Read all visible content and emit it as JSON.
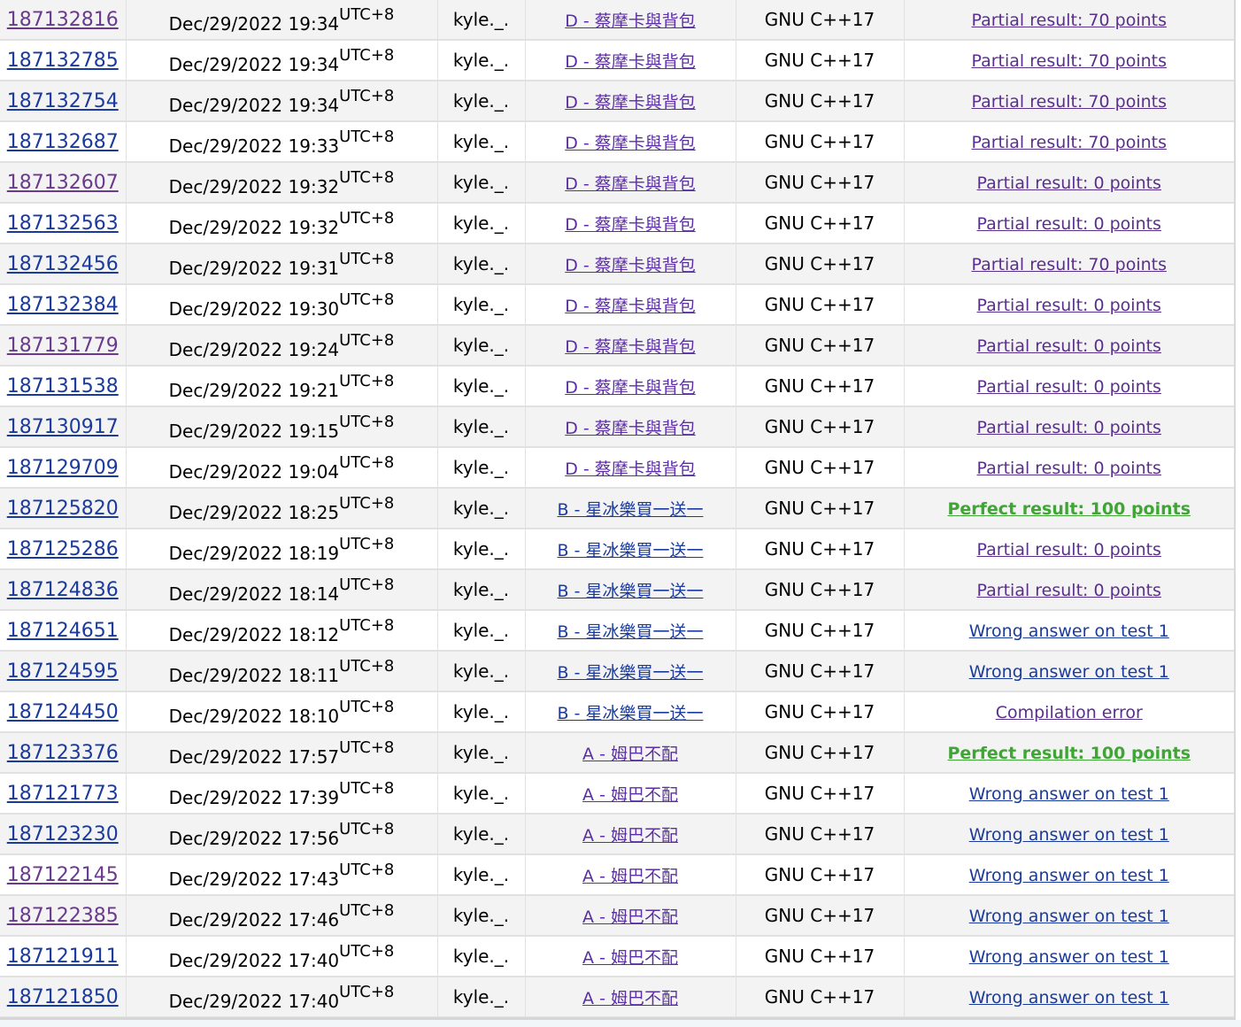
{
  "timezone": "UTC+8",
  "language": "GNU C++17",
  "problems": {
    "A": "A - 姆巴不配",
    "B": "B - 星冰樂買一送一",
    "D": "D - 蔡摩卡與背包"
  },
  "verdicts": {
    "partial70": "Partial result: 70 points",
    "partial0": "Partial result: 0 points",
    "perfect": "Perfect result: 100 points",
    "wrong1": "Wrong answer on test 1",
    "compile": "Compilation error"
  },
  "submissions": [
    {
      "id": "187132816",
      "when": "Dec/29/2022 19:34",
      "tz": "UTC+8",
      "who": "kyle._.",
      "problem": "D - 蔡摩卡與背包",
      "lang": "GNU C++17",
      "verdict": "Partial result: 70 points",
      "verdict_type": "partial",
      "id_visited": true,
      "problem_color": "purple"
    },
    {
      "id": "187132785",
      "when": "Dec/29/2022 19:34",
      "tz": "UTC+8",
      "who": "kyle._.",
      "problem": "D - 蔡摩卡與背包",
      "lang": "GNU C++17",
      "verdict": "Partial result: 70 points",
      "verdict_type": "partial",
      "id_visited": false,
      "problem_color": "purple"
    },
    {
      "id": "187132754",
      "when": "Dec/29/2022 19:34",
      "tz": "UTC+8",
      "who": "kyle._.",
      "problem": "D - 蔡摩卡與背包",
      "lang": "GNU C++17",
      "verdict": "Partial result: 70 points",
      "verdict_type": "partial",
      "id_visited": false,
      "problem_color": "purple"
    },
    {
      "id": "187132687",
      "when": "Dec/29/2022 19:33",
      "tz": "UTC+8",
      "who": "kyle._.",
      "problem": "D - 蔡摩卡與背包",
      "lang": "GNU C++17",
      "verdict": "Partial result: 70 points",
      "verdict_type": "partial",
      "id_visited": false,
      "problem_color": "purple"
    },
    {
      "id": "187132607",
      "when": "Dec/29/2022 19:32",
      "tz": "UTC+8",
      "who": "kyle._.",
      "problem": "D - 蔡摩卡與背包",
      "lang": "GNU C++17",
      "verdict": "Partial result: 0 points",
      "verdict_type": "partial",
      "id_visited": true,
      "problem_color": "purple"
    },
    {
      "id": "187132563",
      "when": "Dec/29/2022 19:32",
      "tz": "UTC+8",
      "who": "kyle._.",
      "problem": "D - 蔡摩卡與背包",
      "lang": "GNU C++17",
      "verdict": "Partial result: 0 points",
      "verdict_type": "partial",
      "id_visited": false,
      "problem_color": "purple"
    },
    {
      "id": "187132456",
      "when": "Dec/29/2022 19:31",
      "tz": "UTC+8",
      "who": "kyle._.",
      "problem": "D - 蔡摩卡與背包",
      "lang": "GNU C++17",
      "verdict": "Partial result: 70 points",
      "verdict_type": "partial",
      "id_visited": false,
      "problem_color": "purple"
    },
    {
      "id": "187132384",
      "when": "Dec/29/2022 19:30",
      "tz": "UTC+8",
      "who": "kyle._.",
      "problem": "D - 蔡摩卡與背包",
      "lang": "GNU C++17",
      "verdict": "Partial result: 0 points",
      "verdict_type": "partial",
      "id_visited": false,
      "problem_color": "purple"
    },
    {
      "id": "187131779",
      "when": "Dec/29/2022 19:24",
      "tz": "UTC+8",
      "who": "kyle._.",
      "problem": "D - 蔡摩卡與背包",
      "lang": "GNU C++17",
      "verdict": "Partial result: 0 points",
      "verdict_type": "partial",
      "id_visited": true,
      "problem_color": "purple"
    },
    {
      "id": "187131538",
      "when": "Dec/29/2022 19:21",
      "tz": "UTC+8",
      "who": "kyle._.",
      "problem": "D - 蔡摩卡與背包",
      "lang": "GNU C++17",
      "verdict": "Partial result: 0 points",
      "verdict_type": "partial",
      "id_visited": false,
      "problem_color": "purple"
    },
    {
      "id": "187130917",
      "when": "Dec/29/2022 19:15",
      "tz": "UTC+8",
      "who": "kyle._.",
      "problem": "D - 蔡摩卡與背包",
      "lang": "GNU C++17",
      "verdict": "Partial result: 0 points",
      "verdict_type": "partial",
      "id_visited": false,
      "problem_color": "purple"
    },
    {
      "id": "187129709",
      "when": "Dec/29/2022 19:04",
      "tz": "UTC+8",
      "who": "kyle._.",
      "problem": "D - 蔡摩卡與背包",
      "lang": "GNU C++17",
      "verdict": "Partial result: 0 points",
      "verdict_type": "partial",
      "id_visited": false,
      "problem_color": "purple"
    },
    {
      "id": "187125820",
      "when": "Dec/29/2022 18:25",
      "tz": "UTC+8",
      "who": "kyle._.",
      "problem": "B - 星冰樂買一送一",
      "lang": "GNU C++17",
      "verdict": "Perfect result: 100 points",
      "verdict_type": "perfect",
      "id_visited": false,
      "problem_color": "blue"
    },
    {
      "id": "187125286",
      "when": "Dec/29/2022 18:19",
      "tz": "UTC+8",
      "who": "kyle._.",
      "problem": "B - 星冰樂買一送一",
      "lang": "GNU C++17",
      "verdict": "Partial result: 0 points",
      "verdict_type": "partial",
      "id_visited": false,
      "problem_color": "blue"
    },
    {
      "id": "187124836",
      "when": "Dec/29/2022 18:14",
      "tz": "UTC+8",
      "who": "kyle._.",
      "problem": "B - 星冰樂買一送一",
      "lang": "GNU C++17",
      "verdict": "Partial result: 0 points",
      "verdict_type": "partial",
      "id_visited": false,
      "problem_color": "blue"
    },
    {
      "id": "187124651",
      "when": "Dec/29/2022 18:12",
      "tz": "UTC+8",
      "who": "kyle._.",
      "problem": "B - 星冰樂買一送一",
      "lang": "GNU C++17",
      "verdict": "Wrong answer on test 1",
      "verdict_type": "wrong",
      "id_visited": false,
      "problem_color": "blue"
    },
    {
      "id": "187124595",
      "when": "Dec/29/2022 18:11",
      "tz": "UTC+8",
      "who": "kyle._.",
      "problem": "B - 星冰樂買一送一",
      "lang": "GNU C++17",
      "verdict": "Wrong answer on test 1",
      "verdict_type": "wrong",
      "id_visited": false,
      "problem_color": "blue"
    },
    {
      "id": "187124450",
      "when": "Dec/29/2022 18:10",
      "tz": "UTC+8",
      "who": "kyle._.",
      "problem": "B - 星冰樂買一送一",
      "lang": "GNU C++17",
      "verdict": "Compilation error",
      "verdict_type": "compile",
      "id_visited": false,
      "problem_color": "blue"
    },
    {
      "id": "187123376",
      "when": "Dec/29/2022 17:57",
      "tz": "UTC+8",
      "who": "kyle._.",
      "problem": "A - 姆巴不配",
      "lang": "GNU C++17",
      "verdict": "Perfect result: 100 points",
      "verdict_type": "perfect",
      "id_visited": false,
      "problem_color": "purple"
    },
    {
      "id": "187121773",
      "when": "Dec/29/2022 17:39",
      "tz": "UTC+8",
      "who": "kyle._.",
      "problem": "A - 姆巴不配",
      "lang": "GNU C++17",
      "verdict": "Wrong answer on test 1",
      "verdict_type": "wrong",
      "id_visited": false,
      "problem_color": "purple"
    },
    {
      "id": "187123230",
      "when": "Dec/29/2022 17:56",
      "tz": "UTC+8",
      "who": "kyle._.",
      "problem": "A - 姆巴不配",
      "lang": "GNU C++17",
      "verdict": "Wrong answer on test 1",
      "verdict_type": "wrong",
      "id_visited": false,
      "problem_color": "purple"
    },
    {
      "id": "187122145",
      "when": "Dec/29/2022 17:43",
      "tz": "UTC+8",
      "who": "kyle._.",
      "problem": "A - 姆巴不配",
      "lang": "GNU C++17",
      "verdict": "Wrong answer on test 1",
      "verdict_type": "wrong",
      "id_visited": true,
      "problem_color": "purple"
    },
    {
      "id": "187122385",
      "when": "Dec/29/2022 17:46",
      "tz": "UTC+8",
      "who": "kyle._.",
      "problem": "A - 姆巴不配",
      "lang": "GNU C++17",
      "verdict": "Wrong answer on test 1",
      "verdict_type": "wrong",
      "id_visited": true,
      "problem_color": "purple"
    },
    {
      "id": "187121911",
      "when": "Dec/29/2022 17:40",
      "tz": "UTC+8",
      "who": "kyle._.",
      "problem": "A - 姆巴不配",
      "lang": "GNU C++17",
      "verdict": "Wrong answer on test 1",
      "verdict_type": "wrong",
      "id_visited": false,
      "problem_color": "purple"
    },
    {
      "id": "187121850",
      "when": "Dec/29/2022 17:40",
      "tz": "UTC+8",
      "who": "kyle._.",
      "problem": "A - 姆巴不配",
      "lang": "GNU C++17",
      "verdict": "Wrong answer on test 1",
      "verdict_type": "wrong",
      "id_visited": false,
      "problem_color": "purple"
    }
  ]
}
